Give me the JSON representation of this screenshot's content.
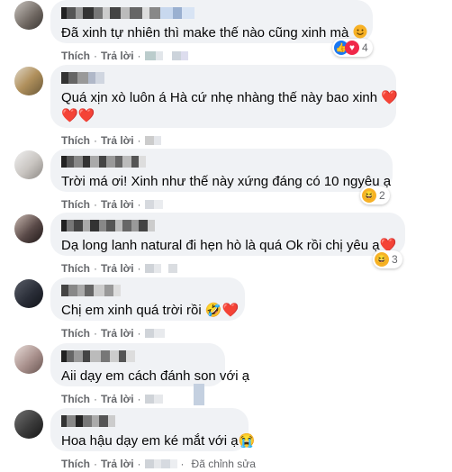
{
  "comments": [
    {
      "text": "Đã xinh tự nhiên thì make thế nào cũng xinh mà",
      "reaction_count": "4"
    },
    {
      "text_line1": "Quá xịn xò luôn á Hà cứ nhẹ nhàng thế này bao xinh"
    },
    {
      "text": "Trời má ơi! Xinh như thế này xứng đáng có 10 ngyêu ạ",
      "reaction_count": "2"
    },
    {
      "text": "Dạ long lanh natural đi hẹn hò là quá Ok rồi chị yêu ạ",
      "reaction_count": "3"
    },
    {
      "text": "Chị em xinh quá trời rồi"
    },
    {
      "text": "Aii dạy em cách đánh son với ạ"
    },
    {
      "text": "Hoa hậu dạy em ké mắt với ạ"
    }
  ],
  "actions": {
    "like": "Thích",
    "reply": "Trả lời",
    "edited": "Đã chỉnh sửa"
  },
  "colors": {
    "bubble": "#f0f2f5",
    "action_text": "#65676b",
    "heart": "#f02849",
    "like": "#1877f2",
    "haha": "#f7b125"
  }
}
